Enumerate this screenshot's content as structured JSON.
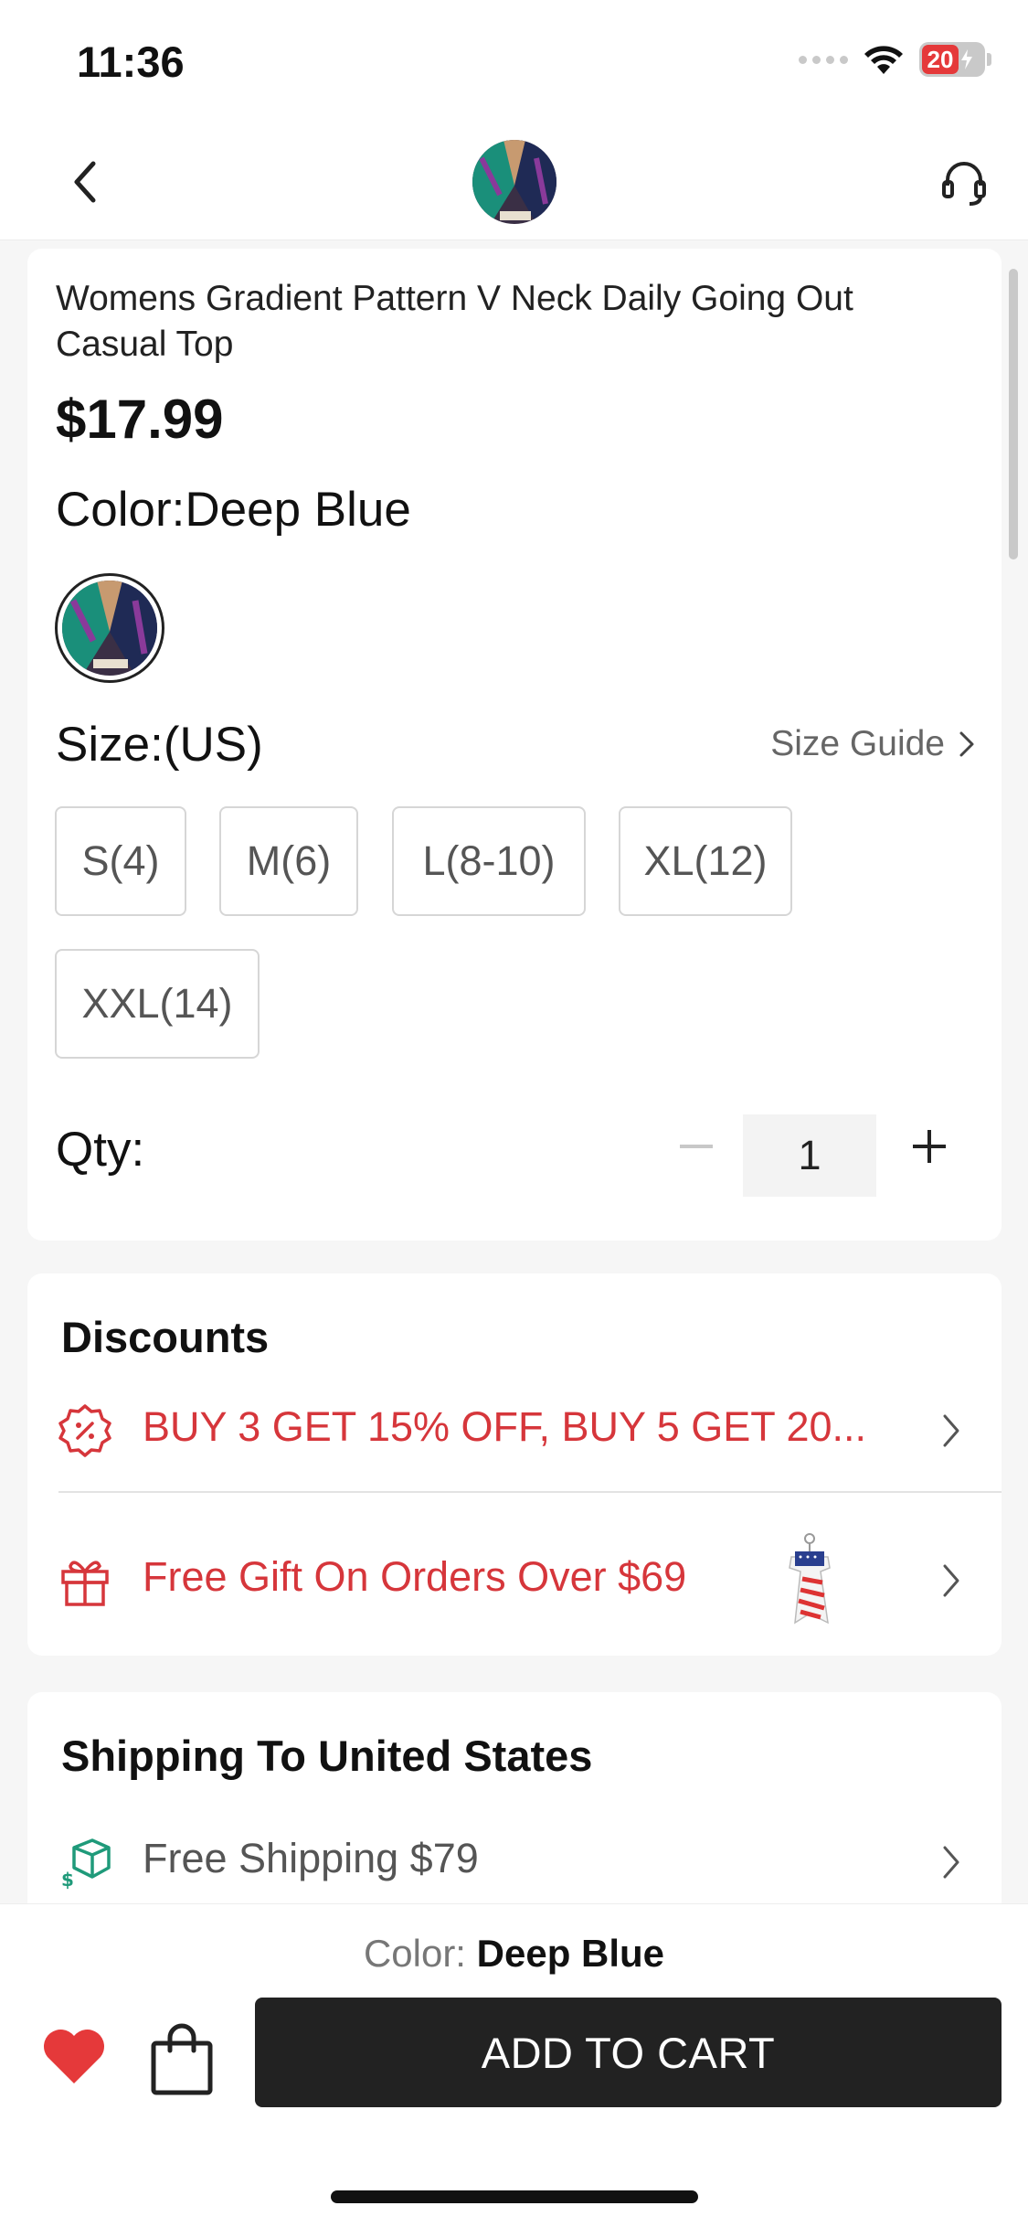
{
  "status_bar": {
    "time": "11:36",
    "battery": "20"
  },
  "product": {
    "title": "Womens Gradient Pattern V Neck Daily Going Out Casual Top",
    "price": "$17.99",
    "color_label": "Color:Deep Blue",
    "size_label": "Size:(US)",
    "size_guide": "Size Guide",
    "sizes": [
      "S(4)",
      "M(6)",
      "L(8-10)",
      "XL(12)",
      "XXL(14)"
    ],
    "qty_label": "Qty:",
    "qty_value": "1"
  },
  "discounts": {
    "heading": "Discounts",
    "offer": "BUY 3 GET 15% OFF, BUY 5 GET 20...",
    "gift": "Free Gift On Orders Over $69"
  },
  "shipping": {
    "heading": "Shipping To United States",
    "free_shipping": "Free Shipping $79"
  },
  "bottom_bar": {
    "color_prefix": "Color:",
    "color_value": "Deep Blue",
    "add_to_cart": "ADD TO CART"
  },
  "colors": {
    "accent_red": "#d6363b",
    "button_dark": "#222222",
    "swatch_teal": "#1a8f7a",
    "swatch_navy": "#1f2a55"
  },
  "icons": [
    "back-icon",
    "support-headset-icon",
    "chevron-right-icon",
    "discount-badge-icon",
    "gift-icon",
    "shipping-box-icon",
    "heart-icon",
    "shopping-bag-icon"
  ]
}
